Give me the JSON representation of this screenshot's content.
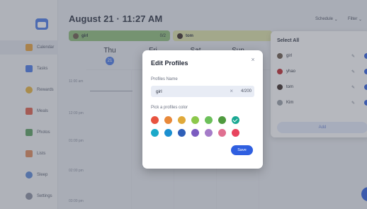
{
  "header": {
    "date_time": "August 21 · 11:27 AM",
    "schedule_label": "Schedule",
    "filter_label": "Filter"
  },
  "sidebar": {
    "items": [
      {
        "label": "Calendar",
        "color": "#e8a33c",
        "active": true
      },
      {
        "label": "Tasks",
        "color": "#4a7be8"
      },
      {
        "label": "Rewards",
        "color": "#e8b33c"
      },
      {
        "label": "Meals",
        "color": "#e0604a"
      },
      {
        "label": "Photos",
        "color": "#5aa060"
      },
      {
        "label": "Lists",
        "color": "#e08a5a"
      },
      {
        "label": "Sleep",
        "color": "#5a88d8"
      },
      {
        "label": "Settings",
        "color": "#8a90a0"
      }
    ]
  },
  "profiles_bar": [
    {
      "name": "girl",
      "count": "0/2",
      "color": "#8fbf7a"
    },
    {
      "name": "tom",
      "color": "#dfe3a8"
    }
  ],
  "days": [
    "Thu",
    "Fri",
    "Sat",
    "Sun"
  ],
  "today_number": "21",
  "hours": [
    "11:00 am",
    "12:00 pm",
    "01:00 pm",
    "02:00 pm",
    "03:00 pm"
  ],
  "panel": {
    "title": "Select All",
    "profiles": [
      {
        "name": "girl",
        "color": "#6b5a4a"
      },
      {
        "name": "yhao",
        "color": "#c0282d"
      },
      {
        "name": "tom",
        "color": "#3a2a25"
      },
      {
        "name": "Kim",
        "color": "#9aa0a8"
      }
    ],
    "add_label": "Add"
  },
  "modal": {
    "title": "Edit Profiles",
    "close_glyph": "×",
    "name_label": "Profiles Name",
    "name_value": "girl",
    "clear_glyph": "×",
    "char_count": "4/200",
    "color_label": "Pick a profiles color",
    "colors_row1": [
      "#e8533f",
      "#e8893a",
      "#e0a93a",
      "#8cc84b",
      "#6cc05a",
      "#4f9a3e",
      "#1aa893"
    ],
    "colors_row2": [
      "#1ba9c9",
      "#1b8fd0",
      "#2f5fb8",
      "#7b5cc0",
      "#a57cc8",
      "#e07091",
      "#e8445e"
    ],
    "selected_color": "#1aa893",
    "save_label": "Save"
  }
}
